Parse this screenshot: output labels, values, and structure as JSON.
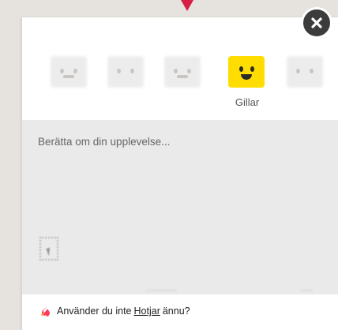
{
  "widget": {
    "ratings": [
      {
        "name": "rating-hate",
        "label": ""
      },
      {
        "name": "rating-dislike",
        "label": ""
      },
      {
        "name": "rating-neutral",
        "label": ""
      },
      {
        "name": "rating-like",
        "label": "Gillar"
      },
      {
        "name": "rating-love",
        "label": ""
      }
    ],
    "selected_rating": "Gillar",
    "feedback": {
      "placeholder": "Berätta om din upplevelse..."
    },
    "footer": {
      "prefix": "Använder du inte",
      "link": "Hotjar",
      "suffix": "ännu?"
    },
    "colors": {
      "accent": "#ffdd00",
      "pointer": "#d61f45",
      "close_button": "#3c3c3c",
      "hotjar_brand": "#fd3a5c"
    },
    "icons": {
      "close": "close-icon",
      "screenshot": "screenshot-select-icon",
      "brand": "hotjar-flame-icon"
    }
  }
}
